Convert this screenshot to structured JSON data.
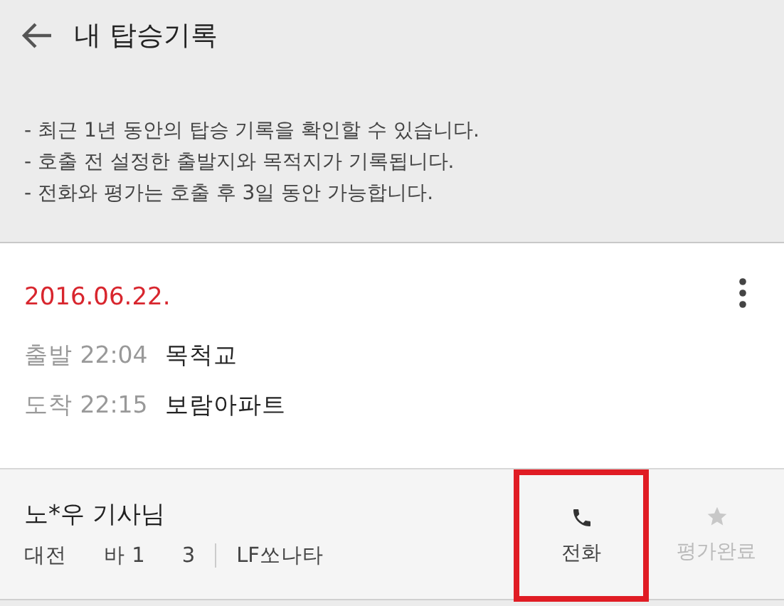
{
  "header": {
    "title": "내 탑승기록"
  },
  "notices": [
    "- 최근 1년 동안의 탑승 기록을 확인할 수 있습니다.",
    "- 호출 전 설정한 출발지와 목적지가 기록됩니다.",
    "- 전화와 평가는 호출 후 3일 동안 가능합니다."
  ],
  "trip": {
    "date": "2016.06.22.",
    "stops": [
      {
        "label": "출발 22:04",
        "place": "목척교"
      },
      {
        "label": "도착 22:15",
        "place": "보람아파트"
      }
    ]
  },
  "driver": {
    "name": "노*우 기사님",
    "plate_parts": [
      "대전",
      "바 1",
      "3"
    ],
    "car": "LF쏘나타"
  },
  "actions": [
    {
      "kind": "call",
      "label": "전화",
      "disabled": false,
      "highlighted": true
    },
    {
      "kind": "rate",
      "label": "평가완료",
      "disabled": true,
      "highlighted": false
    }
  ]
}
